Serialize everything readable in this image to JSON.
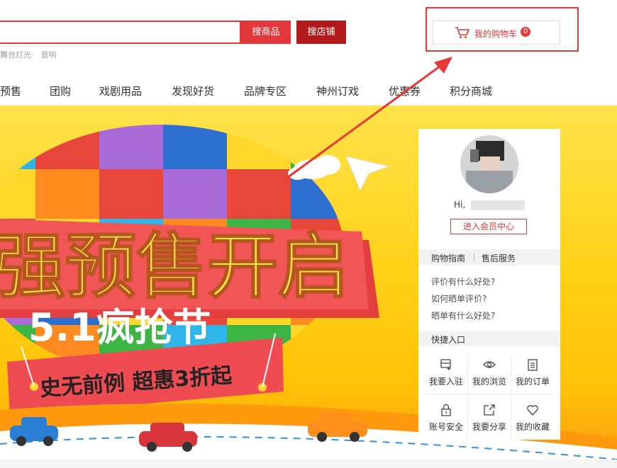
{
  "search": {
    "placeholder": "",
    "btn_goods": "搜商品",
    "btn_shop": "搜店铺",
    "hot_words": [
      "舞台灯光",
      "音响"
    ]
  },
  "cart": {
    "label": "我的购物车",
    "count": "0"
  },
  "nav": {
    "items": [
      "预售",
      "团购",
      "戏剧用品",
      "发现好货",
      "品牌专区",
      "神州订戏",
      "优惠券",
      "积分商城"
    ]
  },
  "banner": {
    "headline": "强预售开启",
    "subline": "5.1疯抢节",
    "ribbon": "史无前例 超惠3折起"
  },
  "user_panel": {
    "greeting": "Hi,",
    "member_center": "进入会员中心",
    "tabs": [
      "购物指南",
      "售后服务"
    ],
    "tips": [
      "评价有什么好处?",
      "如何晒单评价?",
      "晒单有什么好处?"
    ],
    "quick_title": "快捷入口",
    "quick_links": [
      {
        "label": "我要入驻",
        "icon": "store-icon"
      },
      {
        "label": "我的浏览",
        "icon": "eye-icon"
      },
      {
        "label": "我的订单",
        "icon": "order-icon"
      },
      {
        "label": "账号安全",
        "icon": "lock-icon"
      },
      {
        "label": "我要分享",
        "icon": "share-icon"
      },
      {
        "label": "我的收藏",
        "icon": "heart-icon"
      }
    ]
  },
  "colors": {
    "accent": "#e4393c",
    "dark_red": "#b1191a",
    "annotation": "#e53a38",
    "banner_yellow": "#ffd21a"
  }
}
